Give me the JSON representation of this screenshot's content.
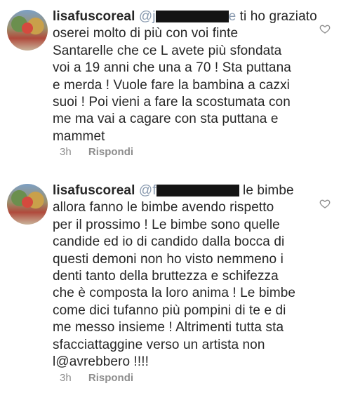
{
  "comments": [
    {
      "username": "lisafuscoreal",
      "mention_visible": "@j",
      "mention_tail": "e",
      "lines": [
        "ti ho graziato",
        "oserei molto di più con voi finte",
        "Santarelle che ce L avete più sfondata",
        "voi a 19 anni che una a 70 ! Sta puttana",
        "e merda ! Vuole fare la bambina a cazxi",
        "suoi ! Poi vieni a fare la scostumata con",
        "me ma vai a cagare con sta puttana e",
        "mammet"
      ],
      "time": "3h",
      "reply_label": "Rispondi",
      "like_icon": "heart-outline-icon"
    },
    {
      "username": "lisafuscoreal",
      "mention_visible": "@f",
      "mention_tail": "",
      "lines": [
        "le bimbe",
        "allora fanno le bimbe avendo rispetto",
        "per il prossimo ! Le bimbe sono quelle",
        "candide ed io di candido dalla bocca di",
        "questi demoni non ho visto nemmeno i",
        "denti tanto della bruttezza e schifezza",
        "che è composta la loro anima ! Le bimbe",
        "come dici tufanno più pompini di te e di",
        "me messo insieme ! Altrimenti tutta sta",
        "sfacciattaggine verso un artista non",
        "l@avrebbero !!!!"
      ],
      "time": "3h",
      "reply_label": "Rispondi",
      "like_icon": "heart-outline-icon"
    }
  ]
}
